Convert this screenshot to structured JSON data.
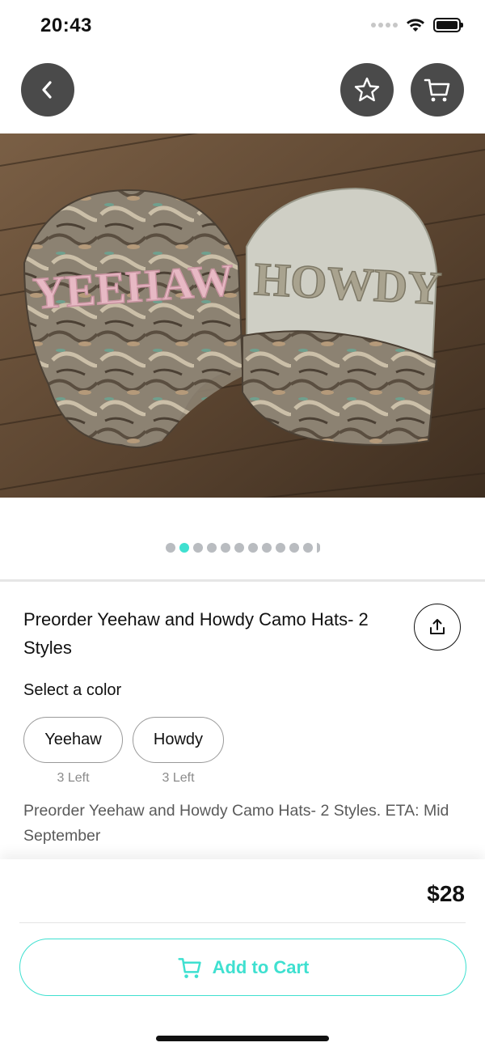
{
  "status_bar": {
    "time": "20:43"
  },
  "header": {
    "back_icon": "chevron-left-icon",
    "favorite_icon": "star-icon",
    "cart_icon": "cart-icon"
  },
  "gallery": {
    "image_count": 12,
    "active_index": 1,
    "hat_left_text": "YEEHAW",
    "hat_right_text": "HOWDY"
  },
  "product": {
    "title": "Preorder Yeehaw and Howdy Camo Hats- 2 Styles",
    "share_icon": "share-icon",
    "select_label": "Select a color",
    "options": [
      {
        "label": "Yeehaw",
        "stock": "3 Left"
      },
      {
        "label": "Howdy",
        "stock": "3 Left"
      }
    ],
    "description": "Preorder Yeehaw and Howdy Camo Hats- 2 Styles. ETA: Mid September"
  },
  "purchase": {
    "price": "$28",
    "add_to_cart_label": "Add to Cart",
    "accent_color": "#3fe0d0"
  }
}
